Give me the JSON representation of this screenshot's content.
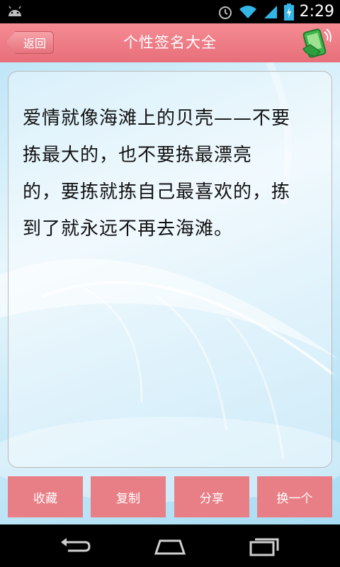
{
  "status": {
    "time": "2:29"
  },
  "appbar": {
    "back_label": "返回",
    "title": "个性签名大全"
  },
  "signature": {
    "lines": [
      "爱情就像海滩上的贝壳——不要",
      "拣最大的，也不要拣最漂亮",
      "的，要拣就拣自己最喜欢的，拣",
      "到了就永远不再去海滩。"
    ]
  },
  "actions": {
    "favorite_label": "收藏",
    "copy_label": "复制",
    "share_label": "分享",
    "next_label": "换一个"
  },
  "colors": {
    "accent": "#e97f86",
    "appbar": "#ef7f88",
    "background": "#cdebf9"
  },
  "icons": [
    "android-icon",
    "alarm-icon",
    "wifi-icon",
    "signal-icon",
    "battery-icon",
    "shake-phone-icon",
    "back-icon",
    "home-icon",
    "recents-icon"
  ]
}
